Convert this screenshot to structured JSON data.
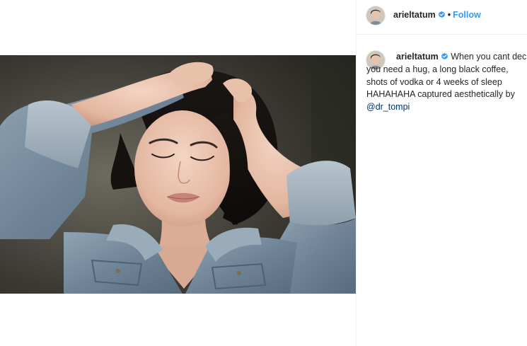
{
  "post": {
    "username": "arieltatum",
    "follow_label": "Follow",
    "separator": "•",
    "caption_lines": [
      "When you cant decide",
      "you need a hug, a long black coffee,",
      "shots of vodka or 4 weeks of sleep",
      "HAHAHAHA captured aesthetically by"
    ],
    "mention": "@dr_tompi"
  },
  "icons": {
    "verified": "verified-badge-icon"
  },
  "colors": {
    "link_blue": "#3897f0",
    "verified_blue": "#3897f0",
    "mention_blue": "#003569",
    "text": "#262626",
    "border": "#efefef"
  }
}
